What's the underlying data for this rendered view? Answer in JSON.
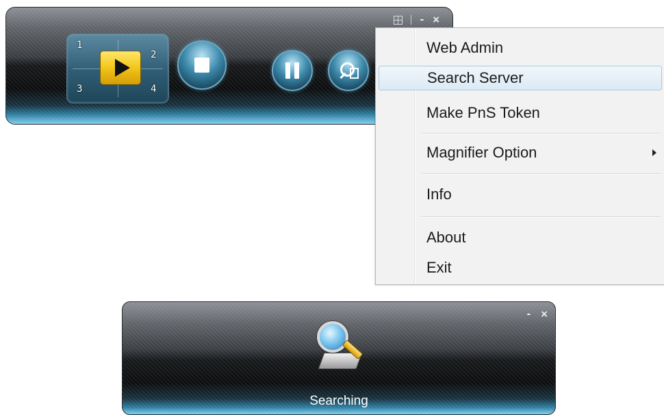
{
  "player": {
    "title_controls": {
      "minimize": "-",
      "close": "×"
    },
    "grid_numbers": [
      "1",
      "2",
      "3",
      "4"
    ]
  },
  "context_menu": {
    "items": [
      {
        "label": "Web Admin"
      },
      {
        "label": "Search Server",
        "highlighted": true
      },
      {
        "label": "Make PnS Token"
      },
      {
        "label": "Magnifier Option",
        "submenu": true
      },
      {
        "label": "Info"
      },
      {
        "label": "About"
      },
      {
        "label": "Exit"
      }
    ]
  },
  "search_window": {
    "controls": {
      "minimize": "-",
      "close": "×"
    },
    "status": "Searching"
  },
  "icons": {
    "layout": "layout-grid-icon",
    "play": "play-icon",
    "stop": "stop-icon",
    "pause": "pause-icon",
    "magnifier": "magnifier-film-icon",
    "search": "search-server-icon"
  },
  "colors": {
    "accent": "#3c89ab",
    "play_button": "#f3c619",
    "highlight": "#dbeaf5"
  }
}
